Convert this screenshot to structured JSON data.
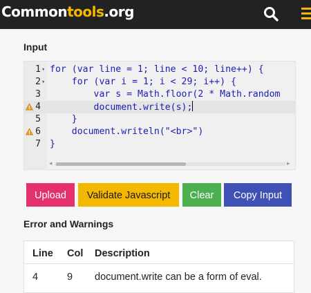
{
  "header": {
    "logo_part1": "Common",
    "logo_part2": "tools",
    "logo_part3": ".org",
    "search_icon": "search-icon",
    "menu_icon": "hamburger-menu-icon",
    "brand_color": "#f5b800"
  },
  "input_section": {
    "label": "Input",
    "lines": [
      {
        "num": "1",
        "fold": "▾",
        "warn": false,
        "code": "for (var line = 1; line < 10; line++) {"
      },
      {
        "num": "2",
        "fold": "▾",
        "warn": false,
        "code": "    for (var i = 1; i < 29; i++) {"
      },
      {
        "num": "3",
        "fold": "",
        "warn": false,
        "code": "        var s = Math.floor(2 * Math.random"
      },
      {
        "num": "4",
        "fold": "",
        "warn": true,
        "code": "        document.write(s);"
      },
      {
        "num": "5",
        "fold": "",
        "warn": false,
        "code": "    }"
      },
      {
        "num": "6",
        "fold": "",
        "warn": true,
        "code": "    document.writeln(\"<br>\")"
      },
      {
        "num": "7",
        "fold": "",
        "warn": false,
        "code": "}"
      }
    ]
  },
  "buttons": {
    "upload": "Upload",
    "validate": "Validate Javascript",
    "clear": "Clear",
    "copy": "Copy Input"
  },
  "errors_section": {
    "label": "Error and Warnings",
    "headers": {
      "line": "Line",
      "col": "Col",
      "description": "Description"
    },
    "rows": [
      {
        "line": "4",
        "col": "9",
        "description": "document.write can be a form of eval."
      }
    ]
  }
}
